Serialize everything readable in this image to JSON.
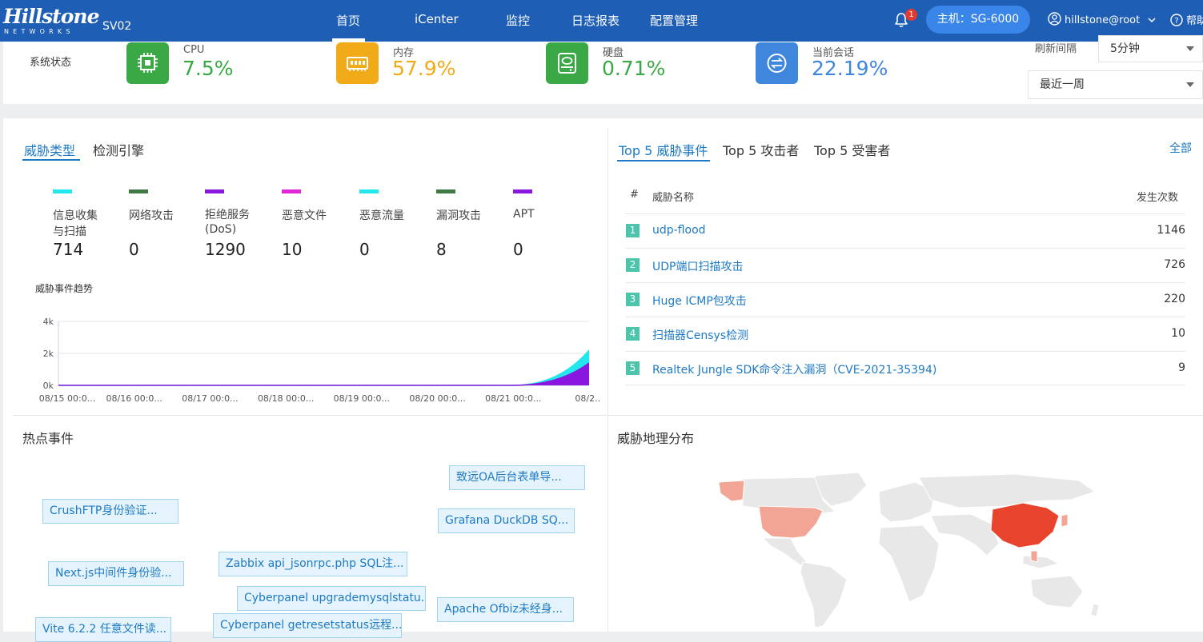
{
  "nav": {
    "brand": "Hillstone",
    "brand_sub": "NETWORKS",
    "device": "SV02",
    "items": [
      "首页",
      "iCenter",
      "监控",
      "日志报表",
      "配置管理"
    ],
    "notification_count": "1",
    "host": "主机：SG-6000",
    "user": "hillstone@root",
    "help": "帮助"
  },
  "status": {
    "title": "系统状态",
    "metrics": [
      {
        "label": "CPU",
        "value": "7.5%",
        "color": "#3aa845"
      },
      {
        "label": "内存",
        "value": "57.9%",
        "color": "#f2ab18"
      },
      {
        "label": "硬盘",
        "value": "0.71%",
        "color": "#3aa845"
      },
      {
        "label": "当前会话",
        "value": "22.19%",
        "color": "#3f86dd"
      }
    ],
    "refresh_label": "刷新间隔",
    "refresh_value": "5分钟",
    "range_value": "最近一周"
  },
  "threats": {
    "tabs": [
      "威胁类型",
      "检测引擎"
    ],
    "categories": [
      {
        "name": "信息收集与扫描",
        "count": "714",
        "color": "#22e8ee"
      },
      {
        "name": "网络攻击",
        "count": "0",
        "color": "#3d7a44"
      },
      {
        "name": "拒绝服务(DoS)",
        "count": "1290",
        "color": "#8a17e0"
      },
      {
        "name": "恶意文件",
        "count": "10",
        "color": "#e126d6"
      },
      {
        "name": "恶意流量",
        "count": "0",
        "color": "#22e8ee"
      },
      {
        "name": "漏洞攻击",
        "count": "8",
        "color": "#3d7a44"
      },
      {
        "name": "APT",
        "count": "0",
        "color": "#8a17e0"
      }
    ],
    "trend_title": "威胁事件趋势"
  },
  "chart_data": {
    "type": "area",
    "x": [
      "08/15 00:0...",
      "08/16 00:0...",
      "08/17 00:0...",
      "08/18 00:0...",
      "08/19 00:0...",
      "08/20 00:0...",
      "08/21 00:0...",
      "08/2..."
    ],
    "yticks": [
      "4k",
      "2k",
      "0k"
    ],
    "ylim": [
      0,
      4000
    ],
    "series": [
      {
        "color": "#22e8ee",
        "values": [
          0,
          0,
          0,
          0,
          0,
          0,
          0,
          2200
        ]
      },
      {
        "color": "#8a17e0",
        "values": [
          0,
          0,
          0,
          0,
          0,
          0,
          0,
          1400
        ]
      }
    ]
  },
  "top5": {
    "tabs": [
      "Top 5 威胁事件",
      "Top 5 攻击者",
      "Top 5 受害者"
    ],
    "all_link": "全部",
    "headers": {
      "num": "#",
      "name": "威胁名称",
      "count": "发生次数"
    },
    "rows": [
      {
        "rank": "1",
        "name": "udp-flood",
        "count": "1146"
      },
      {
        "rank": "2",
        "name": "UDP端口扫描攻击",
        "count": "726"
      },
      {
        "rank": "3",
        "name": "Huge ICMP包攻击",
        "count": "220"
      },
      {
        "rank": "4",
        "name": "扫描器Censys检测",
        "count": "10"
      },
      {
        "rank": "5",
        "name": "Realtek Jungle SDK命令注入漏洞（CVE-2021-35394)",
        "count": "9"
      }
    ]
  },
  "hot": {
    "title": "热点事件",
    "tags": [
      "致远OA后台表单导...",
      "CrushFTP身份验证...",
      "Grafana DuckDB SQ...",
      "Next.js中间件身份验...",
      "Zabbix api_jsonrpc.php SQL注...",
      "Cyberpanel upgrademysqlstatu...",
      "Apache Ofbiz未经身...",
      "Vite 6.2.2 任意文件读...",
      "Cyberpanel getresetstatus远程..."
    ]
  },
  "geo": {
    "title": "威胁地理分布"
  }
}
